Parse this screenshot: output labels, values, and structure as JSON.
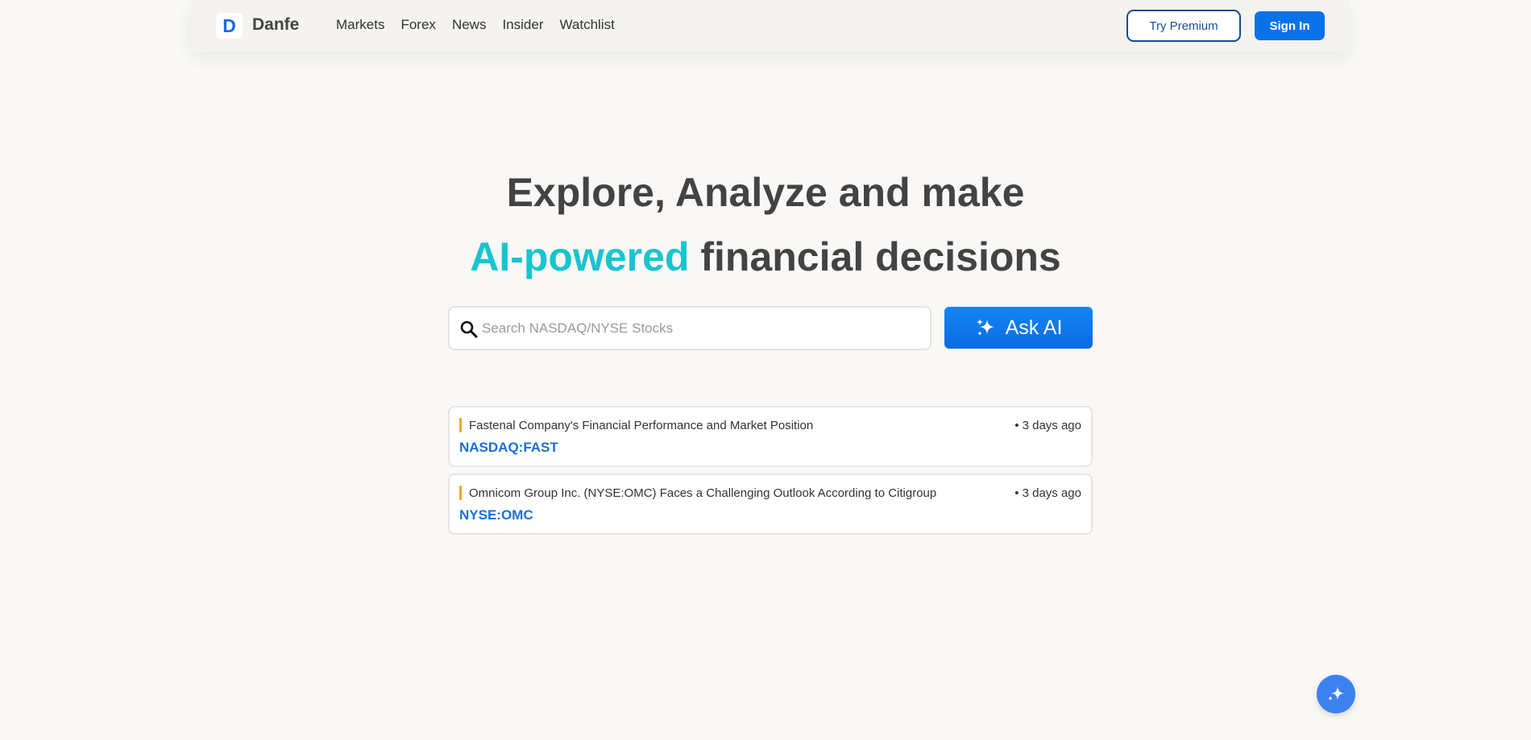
{
  "navbar": {
    "logo_letter": "D",
    "brand": "Danfe",
    "links": [
      "Markets",
      "Forex",
      "News",
      "Insider",
      "Watchlist"
    ],
    "try_premium": "Try Premium",
    "sign_in": "Sign In"
  },
  "hero": {
    "line1": "Explore, Analyze and make",
    "accent": "AI-powered",
    "line2_rest": " financial decisions"
  },
  "search": {
    "placeholder": "Search NASDAQ/NYSE Stocks",
    "value": ""
  },
  "ask_ai": {
    "label": "Ask AI",
    "icon": "sparkle-icon"
  },
  "news": [
    {
      "title": "Fastenal Company's Financial Performance and Market Position",
      "time": "• 3 days ago",
      "ticker": "NASDAQ:FAST"
    },
    {
      "title": "Omnicom Group Inc. (NYSE:OMC) Faces a Challenging Outlook According to Citigroup",
      "time": "• 3 days ago",
      "ticker": "NYSE:OMC"
    }
  ],
  "colors": {
    "brand_blue": "#0a72e8",
    "accent_teal": "#19c4cf",
    "news_marker": "#f5a623",
    "ticker": "#1a6fd6"
  }
}
